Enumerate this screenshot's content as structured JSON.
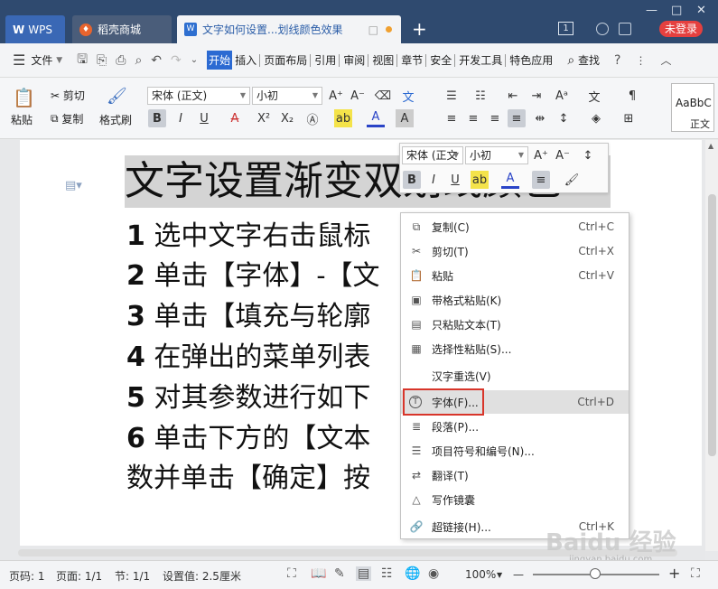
{
  "titlebar": {
    "tabs": [
      {
        "label": "WPS",
        "logo": "W"
      },
      {
        "label": "稻壳商城",
        "icon": "daoke-icon"
      },
      {
        "label": "文字如何设置...划线颜色效果",
        "icon": "writer-doc-icon",
        "close": "□"
      }
    ],
    "new_tab": "+",
    "page_indicator": "1",
    "login_label": "未登录",
    "window_controls": [
      "—",
      "□",
      "✕"
    ]
  },
  "menubar": {
    "file_label": "文件",
    "tabs": [
      "开始",
      "插入",
      "页面布局",
      "引用",
      "审阅",
      "视图",
      "章节",
      "安全",
      "开发工具",
      "特色应用"
    ],
    "active_tab": "开始",
    "search_label": "查找",
    "help": "?",
    "more": "⋮"
  },
  "ribbon": {
    "paste_label": "粘贴",
    "cut_label": "剪切",
    "copy_label": "复制",
    "format_painter_label": "格式刷",
    "font_name": "宋体 (正文)",
    "font_size": "小初",
    "style_preview": "AaBbC",
    "style_name": "正文"
  },
  "mini_toolbar": {
    "font_name": "宋体 (正文",
    "font_size": "小初"
  },
  "document": {
    "title": "文字设置渐变双划线颜色",
    "lines": [
      {
        "num": "1",
        "text": "选中文字右击鼠标"
      },
      {
        "num": "2",
        "text": "单击【字体】-【文"
      },
      {
        "num": "3",
        "text": "单击【填充与轮廓"
      },
      {
        "num": "4",
        "text": "在弹出的菜单列表"
      },
      {
        "num": "5",
        "text": "对其参数进行如下"
      },
      {
        "num": "6",
        "text": "单击下方的【文本"
      },
      {
        "num": "",
        "text": "数并单击【确定】按"
      }
    ]
  },
  "context_menu": {
    "items": [
      {
        "label": "复制(C)",
        "shortcut": "Ctrl+C",
        "icon": "copy-icon"
      },
      {
        "label": "剪切(T)",
        "shortcut": "Ctrl+X",
        "icon": "scissors-icon"
      },
      {
        "label": "粘贴",
        "shortcut": "Ctrl+V",
        "icon": "paste-icon"
      },
      {
        "label": "带格式粘贴(K)",
        "shortcut": "",
        "icon": "paste-format-icon"
      },
      {
        "label": "只粘贴文本(T)",
        "shortcut": "",
        "icon": "paste-text-icon"
      },
      {
        "label": "选择性粘贴(S)...",
        "shortcut": "",
        "icon": "paste-special-icon"
      },
      {
        "label": "汉字重选(V)",
        "shortcut": "",
        "icon": ""
      },
      {
        "label": "字体(F)...",
        "shortcut": "Ctrl+D",
        "icon": "font-icon"
      },
      {
        "label": "段落(P)...",
        "shortcut": "",
        "icon": "paragraph-icon"
      },
      {
        "label": "项目符号和编号(N)...",
        "shortcut": "",
        "icon": "bullets-icon"
      },
      {
        "label": "翻译(T)",
        "shortcut": "",
        "icon": "translate-icon"
      },
      {
        "label": "写作镜囊",
        "shortcut": "",
        "icon": "writing-icon"
      },
      {
        "label": "超链接(H)...",
        "shortcut": "Ctrl+K",
        "icon": "link-icon"
      }
    ],
    "highlighted": "字体(F)..."
  },
  "statusbar": {
    "page_label": "页码: 1",
    "pages_label": "页面: 1/1",
    "section_label": "节: 1/1",
    "setting_label": "设置值: 2.5厘米",
    "zoom_label": "100%",
    "zoom_minus": "—",
    "zoom_plus": "+"
  },
  "watermark": {
    "brand": "Baidu 经验",
    "url": "jingyan.baidu.com"
  }
}
